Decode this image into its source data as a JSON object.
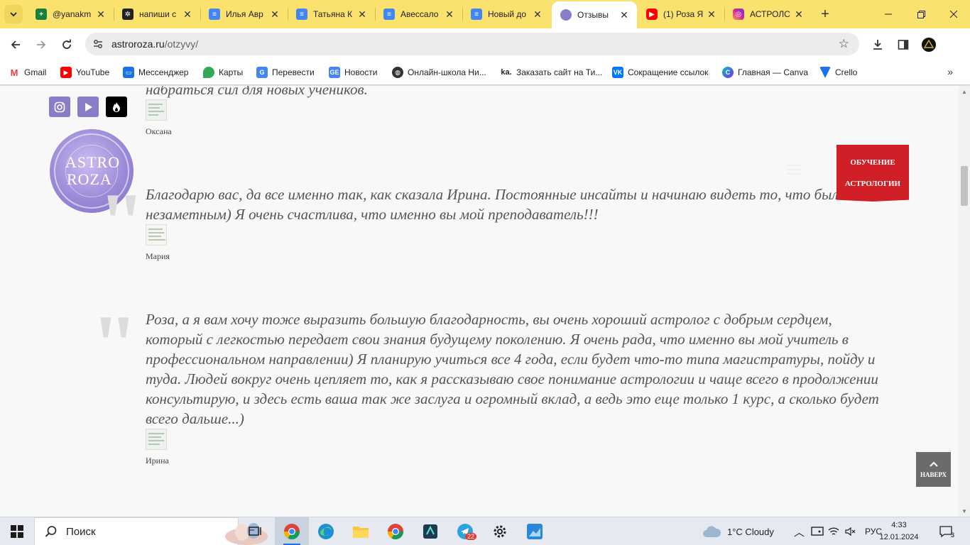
{
  "browser": {
    "tabs": [
      {
        "title": "@yanakm",
        "favicon": "sheets-icon",
        "color": "#188038"
      },
      {
        "title": "напиши с",
        "favicon": "chatgpt-icon",
        "color": "#222222"
      },
      {
        "title": "Илья Авр",
        "favicon": "docs-icon",
        "color": "#4285f4"
      },
      {
        "title": "Татьяна К",
        "favicon": "docs-icon",
        "color": "#4285f4"
      },
      {
        "title": "Авессало",
        "favicon": "docs-icon",
        "color": "#4285f4"
      },
      {
        "title": "Новый до",
        "favicon": "docs-icon",
        "color": "#4285f4"
      },
      {
        "title": "Отзывы",
        "favicon": "astroroza-icon",
        "color": "#8a7cc9",
        "active": true
      },
      {
        "title": "(1) Роза Я",
        "favicon": "youtube-icon",
        "color": "#ff0000"
      },
      {
        "title": "АСТРОЛС",
        "favicon": "instagram-icon",
        "color": "#d6249f"
      }
    ],
    "url_host": "astroroza.ru",
    "url_path": "/otzyvy/",
    "bookmarks": [
      {
        "label": "Gmail",
        "icon": "gmail-icon",
        "color": "#ea4335"
      },
      {
        "label": "YouTube",
        "icon": "youtube-icon",
        "color": "#ff0000"
      },
      {
        "label": "Мессенджер",
        "icon": "messenger-icon",
        "color": "#1a73e8"
      },
      {
        "label": "Карты",
        "icon": "maps-icon",
        "color": "#34a853"
      },
      {
        "label": "Перевести",
        "icon": "translate-icon",
        "color": "#4285f4"
      },
      {
        "label": "Новости",
        "icon": "news-icon",
        "color": "#4285f4"
      },
      {
        "label": "Онлайн-школа Ни...",
        "icon": "globe-icon",
        "color": "#333333"
      },
      {
        "label": "Заказать сайт на Ти...",
        "icon": "tilda-icon",
        "color": "#222222"
      },
      {
        "label": "Сокращение ссылок",
        "icon": "vk-icon",
        "color": "#0077ff"
      },
      {
        "label": "Главная — Canva",
        "icon": "canva-icon",
        "color": "#7d2ae8"
      },
      {
        "label": "Crello",
        "icon": "crello-icon",
        "color": "#1a73e8"
      }
    ]
  },
  "page": {
    "reviews": [
      {
        "text": "набраться сил для новых учеников.",
        "author": "Оксана"
      },
      {
        "text": "Благодарю вас, да все именно так, как сказала Ирина. Постоянные инсайты и начинаю видеть то, что было незаметным) Я очень счастлива, что именно вы мой преподаватель!!!",
        "author": "Мария"
      },
      {
        "text": "Роза, а я вам хочу тоже выразить большую благодарность, вы очень хороший астролог с добрым сердцем, который с легкостью передает свои знания будущему поколению. Я очень рада, что именно вы мой учитель в профессиональном направлении) Я планирую учиться все 4 года, если будет что-то типа магистратуры, пойду и туда. Людей вокруг очень цепляет то, как я рассказываю свое понимание астрологии и чаще всего в продолжении консультирую, и здесь есть ваша так же заслуга и огромный вклад, а ведь это еще только 1 курс, а сколько будет всего дальше...)",
        "author": "Ирина"
      }
    ],
    "logo": {
      "line1": "ASTRO",
      "line2": "ROZA"
    },
    "cta": {
      "line1": "ОБУЧЕНИЕ",
      "line2": "АСТРОЛОГИИ"
    },
    "to_top": "НАВЕРХ",
    "social": [
      {
        "icon": "instagram-icon",
        "color": "#8a7cc9"
      },
      {
        "icon": "youtube-play-icon",
        "color": "#8a7cc9"
      },
      {
        "icon": "fire-icon",
        "color": "#000000"
      }
    ]
  },
  "taskbar": {
    "search_label": "Поиск",
    "weather": "1°C  Cloudy",
    "lang": "РУС",
    "time": "4:33",
    "date": "12.01.2024",
    "notifications": "3",
    "telegram_badge": "22"
  }
}
